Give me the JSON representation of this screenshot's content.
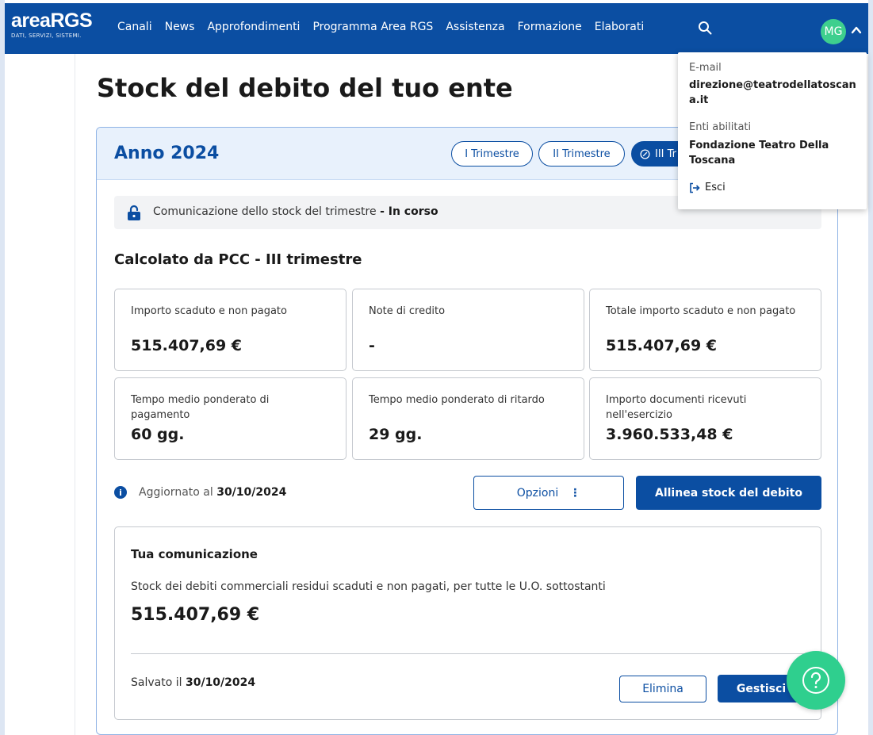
{
  "header": {
    "logo_main": "areaRGS",
    "logo_sub": "DATI, SERVIZI, SISTEMI.",
    "nav": [
      "Canali",
      "News",
      "Approfondimenti",
      "Programma Area RGS",
      "Assistenza",
      "Formazione",
      "Elaborati"
    ],
    "avatar_initials": "MG"
  },
  "page": {
    "title": "Stock del debito del tuo ente"
  },
  "year_card": {
    "year_title": "Anno 2024",
    "quarters": [
      "I Trimestre",
      "II Trimestre",
      "III Trimestre"
    ],
    "active_quarter_label": "III Tr",
    "status_text": "Comunicazione dello stock del trimestre",
    "status_state": "- In corso",
    "section_title": "Calcolato da PCC - III trimestre",
    "stats": [
      {
        "label": "Importo scaduto e non pagato",
        "value": "515.407,69 €"
      },
      {
        "label": "Note di credito",
        "value": "-"
      },
      {
        "label": "Totale importo scaduto e non pagato",
        "value": "515.407,69 €"
      },
      {
        "label": "Tempo medio ponderato di pagamento",
        "value": "60 gg."
      },
      {
        "label": "Tempo medio ponderato di ritardo",
        "value": "29 gg."
      },
      {
        "label": "Importo documenti ricevuti nell'esercizio",
        "value": "3.960.533,48 €"
      }
    ],
    "updated_prefix": "Aggiornato al",
    "updated_date": "30/10/2024",
    "options_label": "Opzioni",
    "options_kebab": "⋮",
    "align_label": "Allinea stock del debito"
  },
  "communication": {
    "title": "Tua comunicazione",
    "description": "Stock dei debiti commerciali residui scaduti e non pagati, per tutte le U.O. sottostanti",
    "value": "515.407,69 €",
    "saved_prefix": "Salvato il",
    "saved_date": "30/10/2024",
    "delete_label": "Elimina",
    "manage_label": "Gestisci"
  },
  "user_menu": {
    "email_label": "E-mail",
    "email_value": "direzione@teatrodellatoscana.it",
    "entities_label": "Enti abilitati",
    "entities_value": "Fondazione Teatro Della Toscana",
    "logout_label": "Esci"
  },
  "colors": {
    "brand_blue": "#0b4ea2",
    "accent_green": "#3ecf8e"
  }
}
